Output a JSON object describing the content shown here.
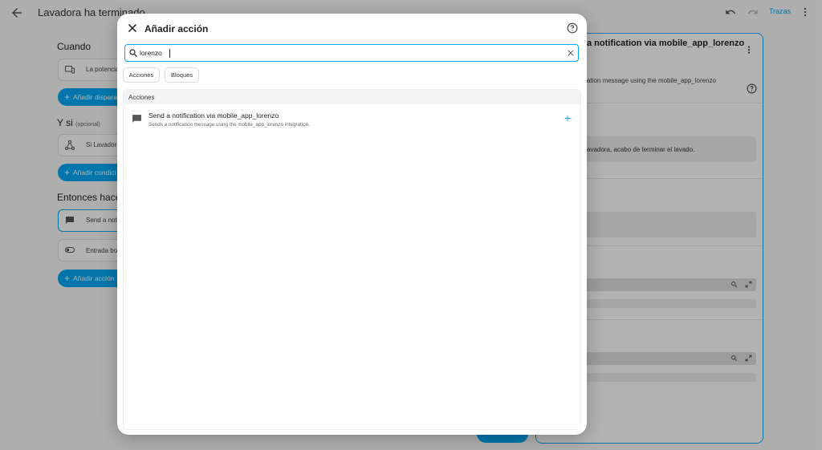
{
  "app": {
    "title": "Lavadora ha terminado",
    "traces_label": "Trazas"
  },
  "editor": {
    "when_title": "Cuando",
    "trigger_card": "La potencia",
    "add_trigger": "Añadir dispara",
    "if_title": "Y si",
    "if_optional": "(opcional)",
    "condition_card": "Si Lavadora",
    "add_condition": "Añadir condici",
    "then_title": "Entonces hace",
    "action_card_1": "Send a noti",
    "action_card_2": "Entrada bo",
    "add_action": "Añadir acción"
  },
  "right_panel": {
    "title": "a notification via mobile_app_lorenzo",
    "subtitle": "ation message using the mobile_app_lorenzo",
    "message_value": "avadora, acabo de terminar el lavado."
  },
  "dialog": {
    "title": "Añadir acción",
    "search": {
      "value": "lorenzo",
      "placeholder": ""
    },
    "chips": [
      "Acciones",
      "Bloques"
    ],
    "group_label": "Acciones",
    "items": [
      {
        "title": "Send a notification via mobile_app_lorenzo",
        "description": "Sends a notification message using the mobile_app_lorenzo integration."
      }
    ]
  },
  "colors": {
    "accent": "#03a9f4",
    "overlay": "rgba(0,0,0,0.30)"
  },
  "icons": {
    "back": "arrow-left-icon",
    "undo": "undo-icon",
    "redo": "redo-icon",
    "more": "dots-vertical-icon",
    "close": "close-icon",
    "help": "help-circle-icon",
    "search": "search-icon",
    "clear": "clear-icon",
    "item": "message-icon",
    "add": "plus-icon"
  }
}
